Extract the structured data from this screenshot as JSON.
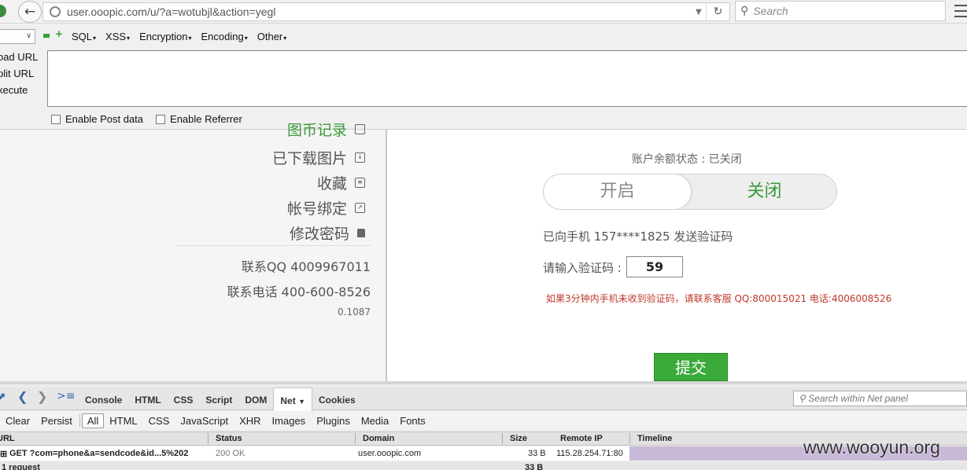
{
  "browser": {
    "url": "user.ooopic.com/u/?a=wotubjl&action=yegl",
    "search_placeholder": "Search"
  },
  "hackbar": {
    "menu": [
      "SQL",
      "XSS",
      "Encryption",
      "Encoding",
      "Other"
    ],
    "actions": [
      "oad URL",
      "plit URL",
      "xecute"
    ],
    "checks": [
      "Enable Post data",
      "Enable Referrer"
    ]
  },
  "sidebar": {
    "items": [
      {
        "label": "图币记录"
      },
      {
        "label": "已下载图片"
      },
      {
        "label": "收藏"
      },
      {
        "label": "帐号绑定"
      },
      {
        "label": "修改密码"
      }
    ],
    "contact_qq": "联系QQ 4009967011",
    "contact_phone": "联系电话 400-600-8526",
    "version": "0.1087"
  },
  "main": {
    "balance_label": "账户余额状态 : 已关闭",
    "toggle_on": "开启",
    "toggle_off": "关闭",
    "sms_info": "已向手机 157****1825 发送验证码",
    "code_label": "请输入验证码 :",
    "code_value": "59",
    "warning": "如果3分钟内手机未收到验证码，请联系客服 QQ:800015021 电话:4006008526",
    "submit": "提交"
  },
  "firebug": {
    "tabs": [
      "Console",
      "HTML",
      "CSS",
      "Script",
      "DOM",
      "Net",
      "Cookies"
    ],
    "active_tab": "Net",
    "search_placeholder": "Search within Net panel",
    "filters": [
      "Clear",
      "Persist",
      "All",
      "HTML",
      "CSS",
      "JavaScript",
      "XHR",
      "Images",
      "Plugins",
      "Media",
      "Fonts"
    ],
    "columns": {
      "url": "URL",
      "status": "Status",
      "domain": "Domain",
      "size": "Size",
      "remote_ip": "Remote IP",
      "timeline": "Timeline"
    },
    "request": {
      "url": "GET ?com=phone&a=sendcode&id...5%202",
      "status": "200 OK",
      "domain": "user.ooopic.com",
      "size": "33 B",
      "remote_ip": "115.28.254.71:80"
    },
    "summary_count": "1 request",
    "summary_size": "33 B"
  },
  "watermark": "www.wooyun.org"
}
